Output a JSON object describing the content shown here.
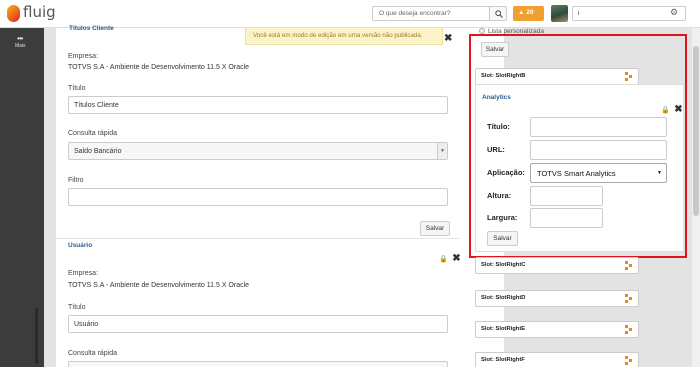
{
  "header": {
    "logo_text": "fluig",
    "logo_sub": "",
    "search_placeholder": "O que deseja encontrar?",
    "alerts_label": "20",
    "user_value": "i"
  },
  "leftnav": {
    "more_label": "Mais"
  },
  "notice": {
    "text": "Você está em modo de edição em uma versão não publicada."
  },
  "widget1": {
    "title": "Títulos Cliente",
    "empresa_label": "Empresa:",
    "empresa_value": "TOTVS S.A - Ambiente de Desenvolvimento 11.5 X Oracle",
    "titulo_label": "Título",
    "titulo_value": "Títulos Cliente",
    "consulta_label": "Consulta rápida",
    "consulta_value": "Saldo Bancário",
    "filtro_label": "Filtro",
    "filtro_value": "",
    "save_label": "Salvar"
  },
  "widget2": {
    "title": "Usuário",
    "empresa_label": "Empresa:",
    "empresa_value": "TOTVS S.A - Ambiente de Desenvolvimento 11.5 X Oracle",
    "titulo_label": "Título",
    "titulo_value": "Usuário",
    "consulta_label": "Consulta rápida"
  },
  "right": {
    "lista_label": "Lista personalizada",
    "top_save_label": "Salvar",
    "slots": [
      "Slot: SlotRightB",
      "Slot: SlotRightC",
      "Slot: SlotRightD",
      "Slot: SlotRightE",
      "Slot: SlotRightF"
    ]
  },
  "analytics": {
    "title": "Analytics",
    "titulo_label": "Título:",
    "url_label": "URL:",
    "aplicacao_label": "Aplicação:",
    "aplicacao_value": "TOTVS Smart Analytics",
    "altura_label": "Altura:",
    "largura_label": "Largura:",
    "save_label": "Salvar"
  },
  "colors": {
    "highlight": "#e0141c",
    "alert": "#f0a030",
    "widget_title": "#2a5d8f"
  }
}
